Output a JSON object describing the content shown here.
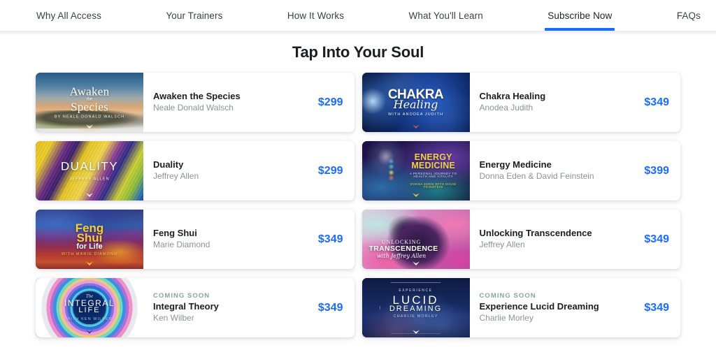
{
  "nav": {
    "items": [
      {
        "label": "Why All Access",
        "active": false
      },
      {
        "label": "Your Trainers",
        "active": false
      },
      {
        "label": "How It Works",
        "active": false
      },
      {
        "label": "What You'll Learn",
        "active": false
      },
      {
        "label": "Subscribe Now",
        "active": true
      },
      {
        "label": "FAQs",
        "active": false
      }
    ]
  },
  "main": {
    "title": "Tap Into Your Soul",
    "accent_color": "#1a6bff",
    "coming_soon_color": "#86a3a2",
    "courses": [
      {
        "title": "Awaken the Species",
        "author": "Neale Donald Walsch",
        "price": "$299",
        "badge": "",
        "cover": {
          "line1": "Awaken",
          "line2": "the",
          "line3": "Species",
          "byline": "BY NEALE DONALD WALSCH"
        }
      },
      {
        "title": "Chakra Healing",
        "author": "Anodea Judith",
        "price": "$349",
        "badge": "",
        "cover": {
          "line1": "CHAKRA",
          "line2": "Healing",
          "byline": "WITH ANODEA JUDITH"
        }
      },
      {
        "title": "Duality",
        "author": "Jeffrey Allen",
        "price": "$299",
        "badge": "",
        "cover": {
          "line1": "DUALITY",
          "byline": "JEFFREY ALLEN"
        }
      },
      {
        "title": "Energy Medicine",
        "author": "Donna Eden & David Feinstein",
        "price": "$399",
        "badge": "",
        "cover": {
          "line1": "ENERGY",
          "line2": "MEDICINE",
          "line3": "A PERSONAL JOURNEY TO HEALTH AND VITALITY",
          "byline": "DONNA EDEN WITH DAVID FEINSTEIN"
        }
      },
      {
        "title": "Feng Shui",
        "author": "Marie Diamond",
        "price": "$349",
        "badge": "",
        "cover": {
          "line1": "Feng",
          "line2": "Shui",
          "line3": "for Life",
          "byline": "WITH MARIE DIAMOND"
        }
      },
      {
        "title": "Unlocking Transcendence",
        "author": "Jeffrey Allen",
        "price": "$349",
        "badge": "",
        "cover": {
          "line1": "UNLOCKING",
          "line2": "TRANSCENDENCE",
          "byline": "with Jeffrey Allen"
        }
      },
      {
        "title": "Integral Theory",
        "author": "Ken Wilber",
        "price": "$349",
        "badge": "COMING SOON",
        "cover": {
          "line1": "The",
          "line2": "INTEGRAL",
          "line3": "LIFE",
          "byline": "WITH KEN WILBER"
        }
      },
      {
        "title": "Experience Lucid Dreaming",
        "author": "Charlie Morley",
        "price": "$349",
        "badge": "COMING SOON",
        "cover": {
          "line1": "EXPERIENCE",
          "line2": "LUCID",
          "line3": "DREAMING",
          "byline": "CHARLIE MORLEY"
        }
      }
    ]
  }
}
